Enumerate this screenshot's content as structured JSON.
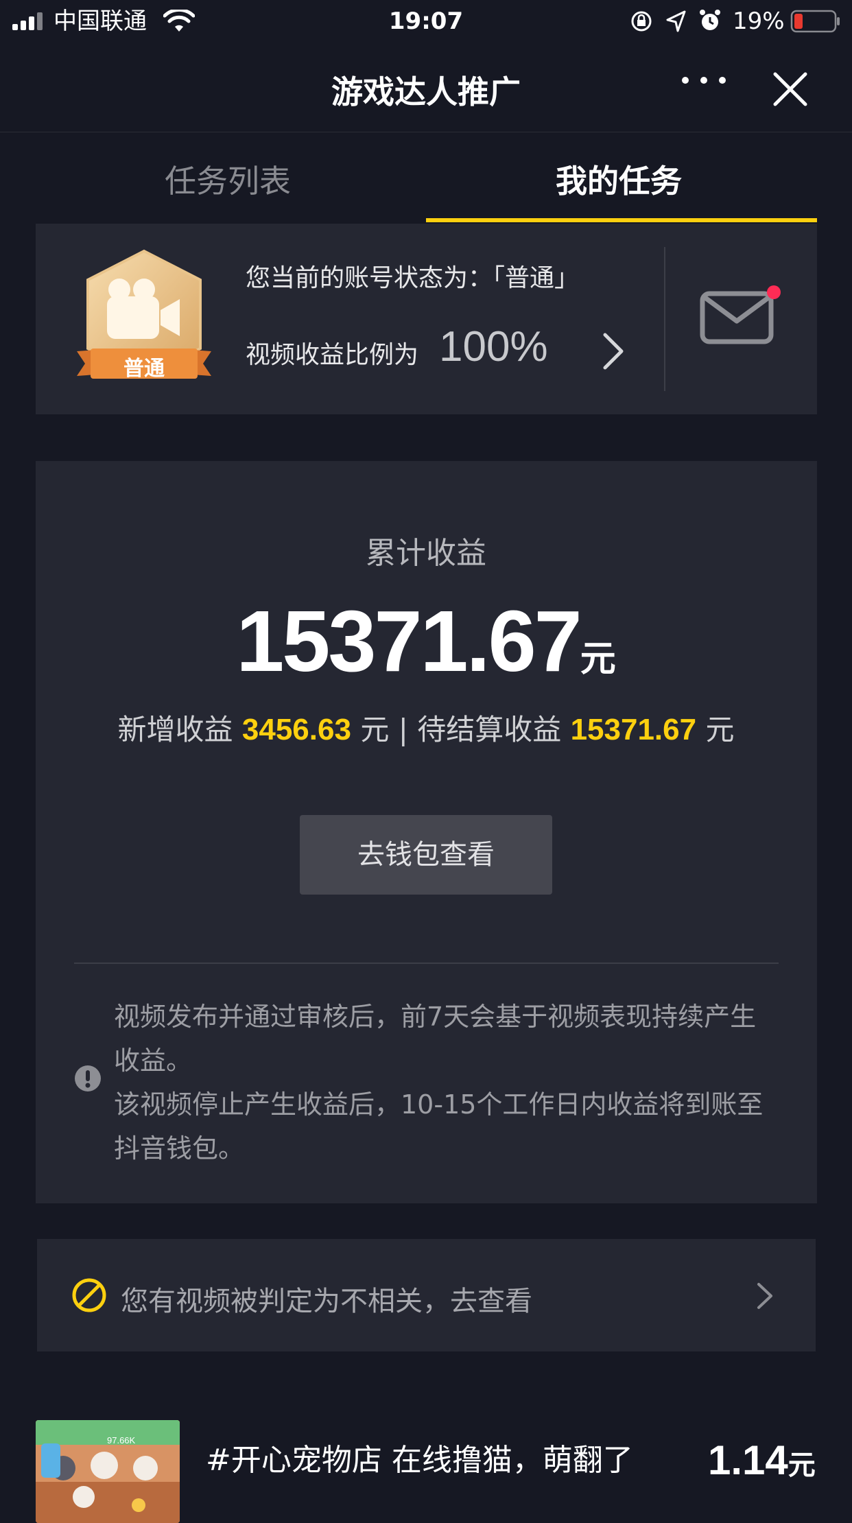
{
  "status_bar": {
    "carrier": "中国联通",
    "time": "19:07",
    "battery": "19%"
  },
  "nav": {
    "title": "游戏达人推广"
  },
  "tabs": {
    "list": "任务列表",
    "mine": "我的任务"
  },
  "account": {
    "status_line": "您当前的账号状态为：「普通」",
    "badge_label": "普通",
    "ratio_label": "视频收益比例为",
    "ratio_value": "100%"
  },
  "earnings": {
    "label": "累计收益",
    "total": "15371.67",
    "unit": "元",
    "new_label": "新增收益",
    "new_value": "3456.63",
    "pending_label": "| 待结算收益",
    "pending_value": "15371.67",
    "wallet_button": "去钱包查看",
    "note1": "视频发布并通过审核后，前7天会基于视频表现持续产生收益。",
    "note2": "该视频停止产生收益后，10-15个工作日内收益将到账至抖音钱包。"
  },
  "notice": {
    "text": "您有视频被判定为不相关，去查看"
  },
  "video": {
    "title": "#开心宠物店 在线撸猫，萌翻了",
    "price": "1.14",
    "unit": "元",
    "thumb_overlay": "97.66K"
  },
  "colors": {
    "background": "#161823",
    "card": "#252732",
    "accent_yellow": "#fdd00f",
    "battery_red": "#e8392f",
    "badge_orange": "#ee8f3c"
  }
}
